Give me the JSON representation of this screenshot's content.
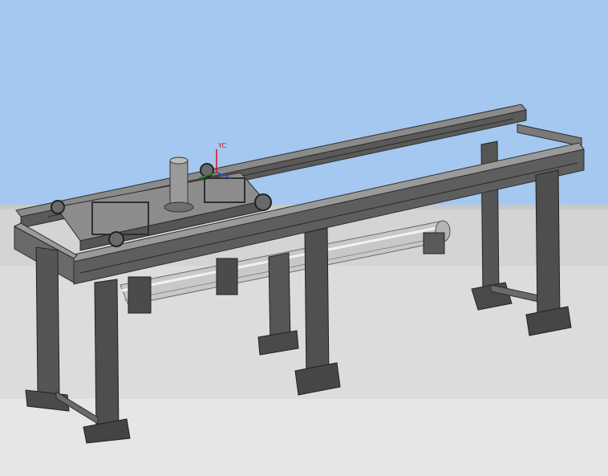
{
  "viewport": {
    "background_sky": "#a4c8ef",
    "floor_band_light": "#d4d4d4",
    "floor_band_mid": "#dcdcdc",
    "floor_near": "#e6e6e6",
    "steel_dark": "#3e3e3e",
    "steel_mid": "#6a6a6a",
    "steel_light": "#9a9a9a",
    "pipe_color": "#c8c8c8"
  },
  "axis_triad": {
    "y_label": "YC",
    "y_axis_color": "#e01010",
    "x_axis_color": "#2a7f2a",
    "z_axis_color": "#3050c0"
  }
}
